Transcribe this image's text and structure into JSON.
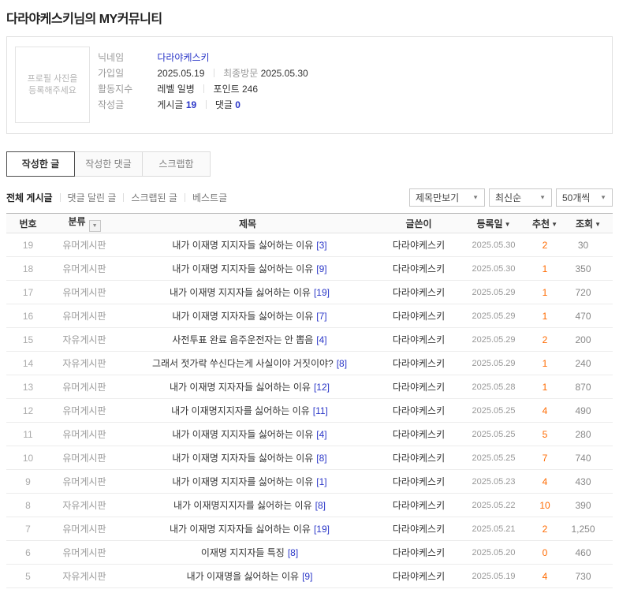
{
  "page": {
    "title": "다라야케스키님의 MY커뮤니티"
  },
  "colors": {
    "link_blue": "#2b37c8",
    "recommend_orange": "#ff6a00"
  },
  "profile": {
    "photo_placeholder_line1": "프로필 사진을",
    "photo_placeholder_line2": "등록해주세요",
    "nickname_label": "닉네임",
    "nickname": "다라야케스키",
    "join_label": "가입일",
    "join_date": "2025.05.19",
    "last_visit_label": "최종방문",
    "last_visit_date": "2025.05.30",
    "activity_label": "활동지수",
    "level_value": "레벨 일병",
    "point_value": "포인트 246",
    "posts_label": "작성글",
    "post_count_label": "게시글",
    "post_count": "19",
    "comment_count_label": "댓글",
    "comment_count": "0"
  },
  "tabs": [
    {
      "label": "작성한 글",
      "active": true
    },
    {
      "label": "작성한 댓글",
      "active": false
    },
    {
      "label": "스크랩함",
      "active": false
    }
  ],
  "filters": [
    {
      "label": "전체 게시글",
      "active": true
    },
    {
      "label": "댓글 달린 글",
      "active": false
    },
    {
      "label": "스크랩된 글",
      "active": false
    },
    {
      "label": "베스트글",
      "active": false
    }
  ],
  "sort_selects": [
    {
      "name": "view-mode-select",
      "label": "제목만보기"
    },
    {
      "name": "sort-order-select",
      "label": "최신순"
    },
    {
      "name": "page-size-select",
      "label": "50개씩"
    }
  ],
  "table": {
    "headers": {
      "no": "번호",
      "category": "분류",
      "title": "제목",
      "author": "글쓴이",
      "date": "등록일",
      "likes": "추천",
      "views": "조회"
    },
    "rows": [
      {
        "no": "19",
        "category": "유머게시판",
        "title": "내가 이재명 지지자들 싫어하는 이유",
        "comments": "[3]",
        "author": "다라야케스키",
        "date": "2025.05.30",
        "likes": "2",
        "views": "30"
      },
      {
        "no": "18",
        "category": "유머게시판",
        "title": "내가 이재명 지지자들 싫어하는 이유",
        "comments": "[9]",
        "author": "다라야케스키",
        "date": "2025.05.30",
        "likes": "1",
        "views": "350"
      },
      {
        "no": "17",
        "category": "유머게시판",
        "title": "내가 이재명 지지자들 싫어하는 이유",
        "comments": "[19]",
        "author": "다라야케스키",
        "date": "2025.05.29",
        "likes": "1",
        "views": "720"
      },
      {
        "no": "16",
        "category": "유머게시판",
        "title": "내가 이재명 지자자들 싫어하는 이유",
        "comments": "[7]",
        "author": "다라야케스키",
        "date": "2025.05.29",
        "likes": "1",
        "views": "470"
      },
      {
        "no": "15",
        "category": "자유게시판",
        "title": "사전투표 완료 음주운전자는 안 뽑음",
        "comments": "[4]",
        "author": "다라야케스키",
        "date": "2025.05.29",
        "likes": "2",
        "views": "200"
      },
      {
        "no": "14",
        "category": "자유게시판",
        "title": "그래서 젓가락 쑤신다는게 사실이야 거짓이야?",
        "comments": "[8]",
        "author": "다라야케스키",
        "date": "2025.05.29",
        "likes": "1",
        "views": "240"
      },
      {
        "no": "13",
        "category": "유머게시판",
        "title": "내가 이재명 지자자들 싫어하는 이유",
        "comments": "[12]",
        "author": "다라야케스키",
        "date": "2025.05.28",
        "likes": "1",
        "views": "870"
      },
      {
        "no": "12",
        "category": "유머게시판",
        "title": "내가 이재명지지자를 싫어하는 이유",
        "comments": "[11]",
        "author": "다라야케스키",
        "date": "2025.05.25",
        "likes": "4",
        "views": "490"
      },
      {
        "no": "11",
        "category": "유머게시판",
        "title": "내가 이재명 지지자들 싫어하는 이유",
        "comments": "[4]",
        "author": "다라야케스키",
        "date": "2025.05.25",
        "likes": "5",
        "views": "280"
      },
      {
        "no": "10",
        "category": "유머게시판",
        "title": "내가 이재명 지자자들 싫어하는 이유",
        "comments": "[8]",
        "author": "다라야케스키",
        "date": "2025.05.25",
        "likes": "7",
        "views": "740"
      },
      {
        "no": "9",
        "category": "유머게시판",
        "title": "내가 이재명 지지자를 싫어하는 이유",
        "comments": "[1]",
        "author": "다라야케스키",
        "date": "2025.05.23",
        "likes": "4",
        "views": "430"
      },
      {
        "no": "8",
        "category": "자유게시판",
        "title": "내가 이재명지지자를 싫어하는 이유",
        "comments": "[8]",
        "author": "다라야케스키",
        "date": "2025.05.22",
        "likes": "10",
        "views": "390"
      },
      {
        "no": "7",
        "category": "유머게시판",
        "title": "내가 이재명 지자자들 싫어하는 이유",
        "comments": "[19]",
        "author": "다라야케스키",
        "date": "2025.05.21",
        "likes": "2",
        "views": "1,250"
      },
      {
        "no": "6",
        "category": "유머게시판",
        "title": "이재명 지지자들 특징",
        "comments": "[8]",
        "author": "다라야케스키",
        "date": "2025.05.20",
        "likes": "0",
        "views": "460"
      },
      {
        "no": "5",
        "category": "자유게시판",
        "title": "내가 이재명을 싫어하는 이유",
        "comments": "[9]",
        "author": "다라야케스키",
        "date": "2025.05.19",
        "likes": "4",
        "views": "730"
      }
    ]
  }
}
